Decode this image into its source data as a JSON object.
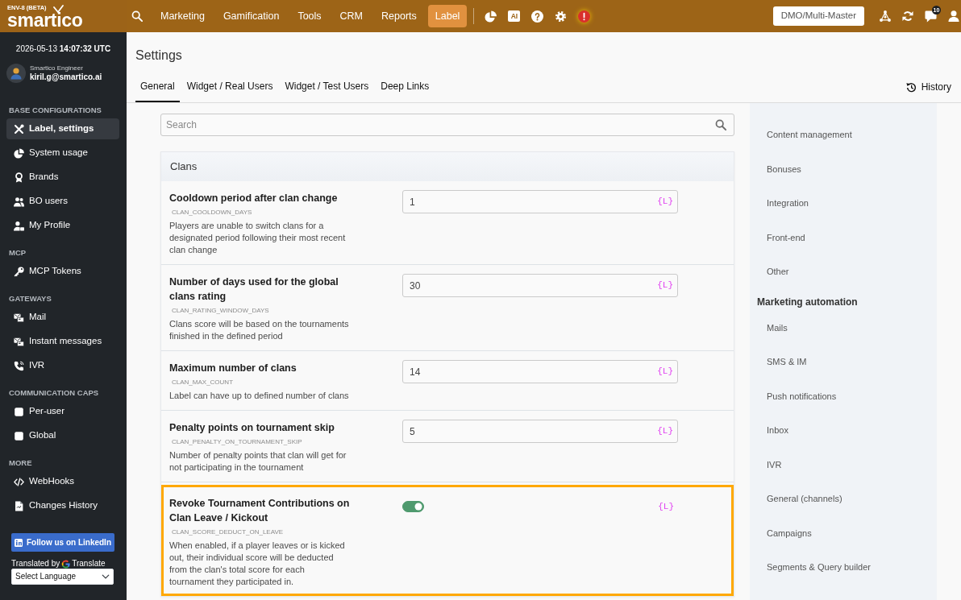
{
  "brand": {
    "env": "ENV-8 (BETA)",
    "logo": "smartico"
  },
  "top_nav": {
    "items": [
      {
        "label": "Marketing",
        "selected": false
      },
      {
        "label": "Gamification",
        "selected": false
      },
      {
        "label": "Tools",
        "selected": false
      },
      {
        "label": "CRM",
        "selected": false
      },
      {
        "label": "Reports",
        "selected": false
      },
      {
        "label": "Label",
        "selected": true
      }
    ],
    "ai_button": "AI",
    "account_button": "DMO/Multi-Master",
    "messages_badge": "10"
  },
  "sidebar": {
    "clock": "2026-05-13 **14:07:32 UTC**",
    "user": {
      "role": "Smartico Engineer",
      "email": "kiril.g@smartico.ai"
    },
    "sections": [
      {
        "title": "BASE CONFIGURATIONS",
        "items": [
          {
            "label": "Label, settings",
            "selected": true
          },
          {
            "label": "System usage",
            "selected": false
          },
          {
            "label": "Brands",
            "selected": false
          },
          {
            "label": "BO users",
            "selected": false
          },
          {
            "label": "My Profile",
            "selected": false
          }
        ]
      },
      {
        "title": "MCP",
        "items": [
          {
            "label": "MCP Tokens",
            "selected": false
          }
        ]
      },
      {
        "title": "GATEWAYS",
        "items": [
          {
            "label": "Mail",
            "selected": false
          },
          {
            "label": "Instant messages",
            "selected": false
          },
          {
            "label": "IVR",
            "selected": false
          }
        ]
      },
      {
        "title": "COMMUNICATION CAPS",
        "items": [
          {
            "label": "Per-user",
            "selected": false
          },
          {
            "label": "Global",
            "selected": false
          }
        ]
      },
      {
        "title": "MORE",
        "items": [
          {
            "label": "WebHooks",
            "selected": false
          },
          {
            "label": "Changes History",
            "selected": false
          }
        ]
      }
    ],
    "linkedin_button": "Follow us on LinkedIn",
    "translate": {
      "prefix": "Translated by",
      "name": "Translate",
      "select": "Select Language"
    }
  },
  "page": {
    "title": "Settings",
    "tabs": [
      {
        "label": "General",
        "selected": true
      },
      {
        "label": "Widget / Real Users",
        "selected": false
      },
      {
        "label": "Widget / Test Users",
        "selected": false
      },
      {
        "label": "Deep Links",
        "selected": false
      }
    ],
    "history_button": "History"
  },
  "search": {
    "placeholder": "Search"
  },
  "section": {
    "title": "Clans",
    "settings": [
      {
        "kind": "number",
        "title": "Cooldown period after clan change",
        "key": "CLAN_COOLDOWN_DAYS",
        "description": "Players are unable to switch clans for a designated period following their most recent clan change",
        "value": "1",
        "tag": "{L}",
        "highlighted": false
      },
      {
        "kind": "number",
        "title": "Number of days used for the global clans rating",
        "key": "CLAN_RATING_WINDOW_DAYS",
        "description": "Clans score will be based on the tournaments finished in the defined period",
        "value": "30",
        "tag": "{L}",
        "highlighted": false
      },
      {
        "kind": "number",
        "title": "Maximum number of clans",
        "key": "CLAN_MAX_COUNT",
        "description": "Label can have up to defined number of clans",
        "value": "14",
        "tag": "{L}",
        "highlighted": false
      },
      {
        "kind": "number",
        "title": "Penalty points on tournament skip",
        "key": "CLAN_PENALTY_ON_TOURNAMENT_SKIP",
        "description": "Number of penalty points that clan will get for not participating in the tournament",
        "value": "5",
        "tag": "{L}",
        "highlighted": false
      },
      {
        "kind": "toggle",
        "title": "Revoke Tournament Contributions on Clan Leave / Kickout",
        "key": "CLAN_SCORE_DEDUCT_ON_LEAVE",
        "description": "When enabled, if a player leaves or is kicked out, their individual score will be deducted from the clan's total score for each tournament they participated in.",
        "on": true,
        "tag": "{L}",
        "highlighted": true
      }
    ]
  },
  "settings_nav": [
    {
      "label": "Content management"
    },
    {
      "label": "Bonuses"
    },
    {
      "label": "Integration"
    },
    {
      "label": "Front-end"
    },
    {
      "label": "Other"
    },
    {
      "label": "Marketing automation",
      "children": [
        {
          "label": "Mails"
        },
        {
          "label": "SMS & IM"
        },
        {
          "label": "Push notifications"
        },
        {
          "label": "Inbox"
        },
        {
          "label": "IVR"
        },
        {
          "label": "General (channels)"
        },
        {
          "label": "Campaigns"
        },
        {
          "label": "Segments & Query builder"
        }
      ]
    }
  ]
}
